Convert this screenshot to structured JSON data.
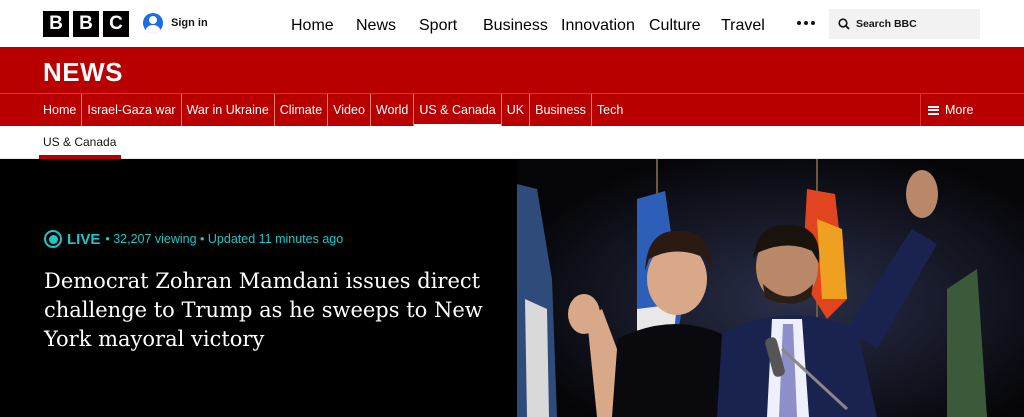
{
  "header": {
    "logo_letters": [
      "B",
      "B",
      "C"
    ],
    "signin_label": "Sign in",
    "nav": [
      {
        "label": "Home"
      },
      {
        "label": "News"
      },
      {
        "label": "Sport"
      },
      {
        "label": "Business"
      },
      {
        "label": "Innovation"
      },
      {
        "label": "Culture"
      },
      {
        "label": "Travel"
      }
    ],
    "more_icon": "ellipsis-icon",
    "search_label": "Search BBC"
  },
  "news_band": {
    "title": "NEWS"
  },
  "section_nav": {
    "items": [
      {
        "label": "Home"
      },
      {
        "label": "Israel-Gaza war"
      },
      {
        "label": "War in Ukraine"
      },
      {
        "label": "Climate"
      },
      {
        "label": "Video"
      },
      {
        "label": "World"
      },
      {
        "label": "US & Canada",
        "active": true
      },
      {
        "label": "UK"
      },
      {
        "label": "Business"
      },
      {
        "label": "Tech"
      }
    ],
    "more_label": "More"
  },
  "sub_nav": {
    "active_item": "US & Canada"
  },
  "hero": {
    "live_label": "LIVE",
    "live_meta": "• 32,207 viewing • Updated 11 minutes ago",
    "headline": "Democrat Zohran Mamdani issues direct challenge to Trump as he sweeps to New York mayoral victory"
  },
  "colors": {
    "brand_red": "#b80000",
    "live_teal": "#1ec6c6",
    "signin_blue": "#1e6be6"
  }
}
